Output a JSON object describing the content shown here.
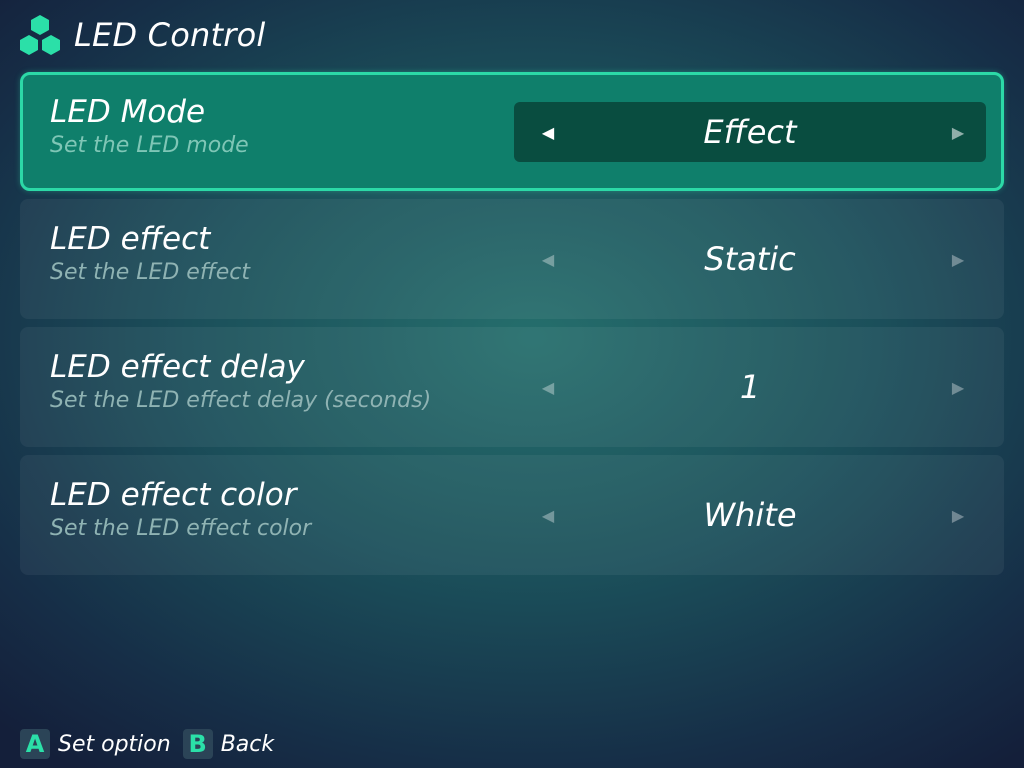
{
  "header": {
    "title": "LED Control",
    "icon": "cubes-icon",
    "accent_color": "#2cd9a7"
  },
  "settings": [
    {
      "label": "LED Mode",
      "description": "Set the LED mode",
      "value": "Effect",
      "selected": true
    },
    {
      "label": "LED effect",
      "description": "Set the LED effect",
      "value": "Static",
      "selected": false
    },
    {
      "label": "LED effect delay",
      "description": "Set the LED effect delay (seconds)",
      "value": "1",
      "selected": false
    },
    {
      "label": "LED effect color",
      "description": "Set the LED effect color",
      "value": "White",
      "selected": false
    }
  ],
  "footer": {
    "hints": [
      {
        "key": "A",
        "label": "Set option"
      },
      {
        "key": "B",
        "label": "Back"
      }
    ]
  }
}
